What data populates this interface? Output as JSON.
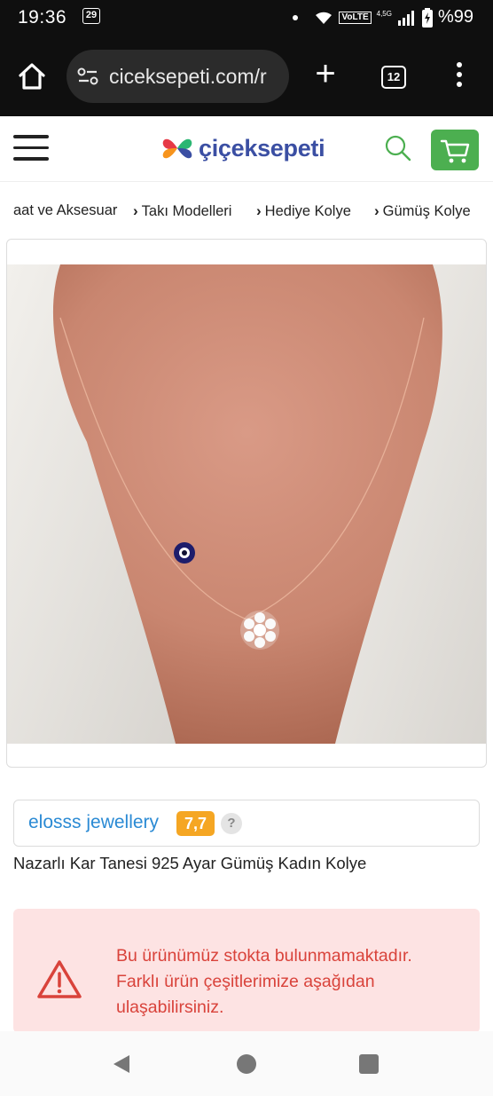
{
  "status_bar": {
    "time": "19:36",
    "date_badge": "29",
    "volte": "VoLTE",
    "network": "4,5G",
    "battery": "%99"
  },
  "browser": {
    "url": "ciceksepeti.com/r",
    "tab_count": "12"
  },
  "header": {
    "logo_text": "çiçeksepeti",
    "cart_color": "#4caf50",
    "search_color": "#4caf50"
  },
  "breadcrumb": [
    {
      "label": "aat ve Aksesuar"
    },
    {
      "label": "Takı Modelleri"
    },
    {
      "label": "Hediye Kolye"
    },
    {
      "label": "Gümüş Kolye"
    }
  ],
  "seller": {
    "name": "elosss jewellery",
    "score": "7,7",
    "help": "?"
  },
  "product": {
    "title": "Nazarlı Kar Tanesi 925 Ayar Gümüş Kadın Kolye"
  },
  "stock_warning": {
    "lines": [
      "Bu ürünümüz stokta bulunmamaktadır.",
      "Farklı ürün çeşitlerimize aşağıdan",
      "ulaşabilirsiniz."
    ],
    "color": "#d9433b"
  }
}
